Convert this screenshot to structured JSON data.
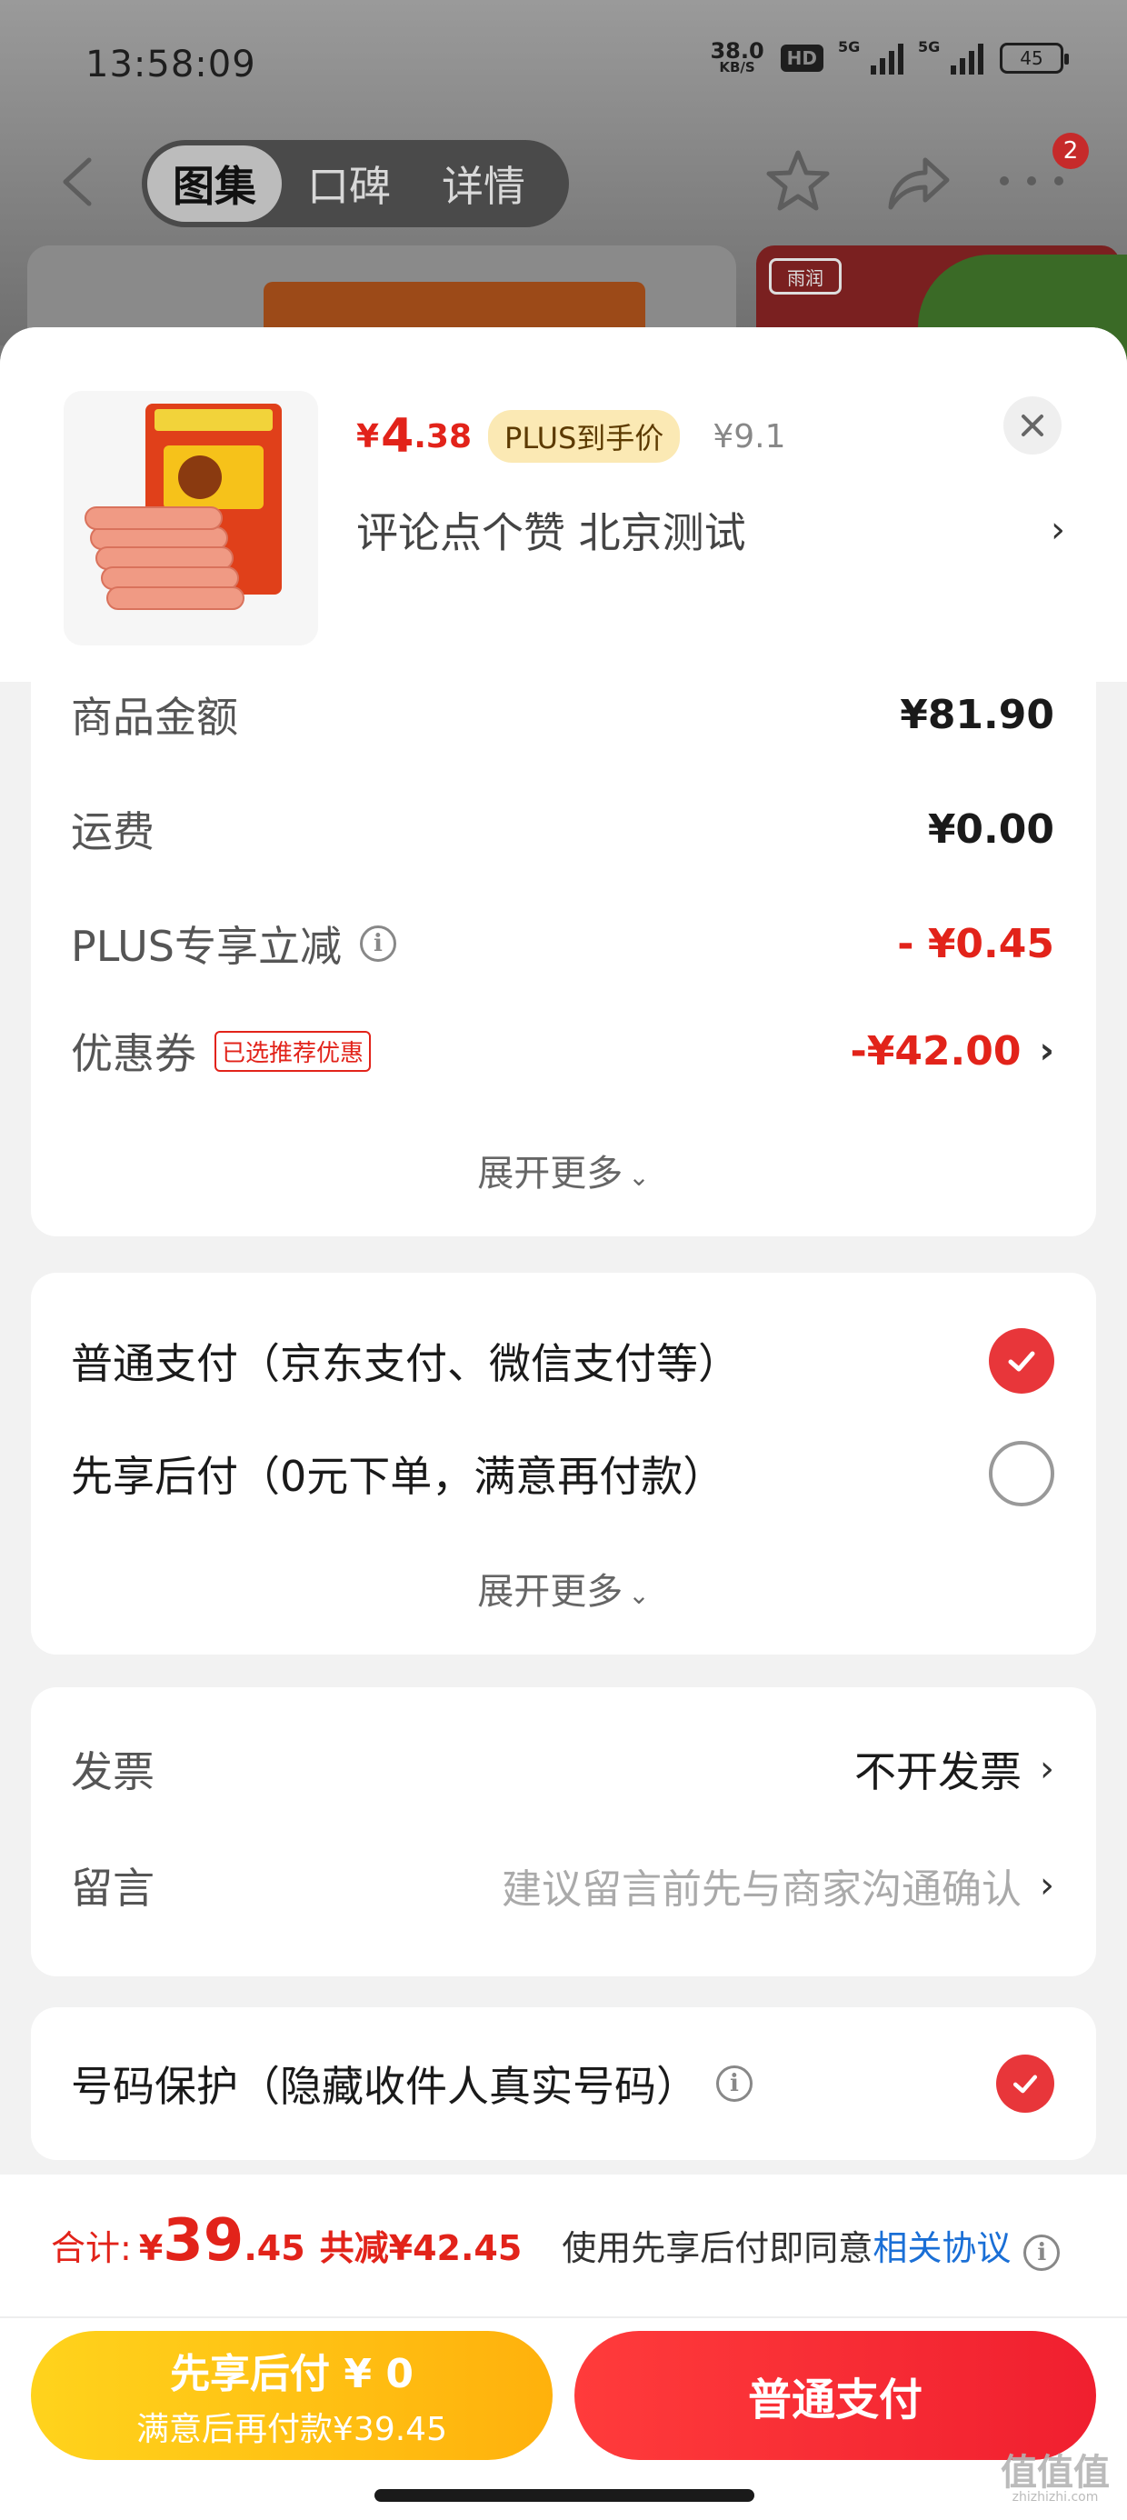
{
  "status_bar": {
    "time": "13:58:09",
    "net_speed": "38.0",
    "net_unit": "KB/S",
    "hd": "HD",
    "sig1": "5G",
    "sig2": "5G",
    "battery": "45"
  },
  "nav": {
    "tabs": [
      {
        "label": "图集",
        "active": true
      },
      {
        "label": "口碑",
        "active": false
      },
      {
        "label": "详情",
        "active": false
      }
    ],
    "more_badge": "2",
    "bg_logo": "雨润"
  },
  "product": {
    "price_symbol": "¥",
    "price_int": "4",
    "price_dec": ".38",
    "plus_tag": "PLUS到手价",
    "orig_price": "¥9.1",
    "spec": "评论点个赞  北京测试"
  },
  "price_detail": {
    "rows": [
      {
        "label": "商品金额",
        "value": "¥81.90"
      },
      {
        "label": "运费",
        "value": "¥0.00"
      },
      {
        "label": "PLUS专享立减",
        "value": "- ¥0.45"
      },
      {
        "label": "优惠券",
        "tag": "已选推荐优惠",
        "value": "-¥42.00"
      }
    ],
    "expand": "展开更多"
  },
  "payment": {
    "options": [
      {
        "label": "普通支付（京东支付、微信支付等）",
        "selected": true
      },
      {
        "label": "先享后付（0元下单，满意再付款）",
        "selected": false
      }
    ],
    "expand": "展开更多"
  },
  "invoice": {
    "label": "发票",
    "value": "不开发票",
    "note_label": "留言",
    "note_placeholder": "建议留言前先与商家沟通确认"
  },
  "protection": {
    "label": "号码保护（隐藏收件人真实号码）",
    "checked": true
  },
  "footer": {
    "total_label": "合计:",
    "total_symbol": "¥",
    "total_int": "39",
    "total_dec": ".45",
    "total_save": "共减¥42.45",
    "agree_text": "使用先享后付即同意",
    "agree_link": "相关协议",
    "btn_later_line1": "先享后付 ¥ 0",
    "btn_later_line2": "满意后再付款¥39.45",
    "btn_pay": "普通支付"
  },
  "watermark": {
    "text": "值值值",
    "url": "zhizhizhi.com"
  },
  "colors": {
    "accent_red": "#e2231a",
    "link_blue": "#1a6fd6",
    "later_button": "#ffc414",
    "pay_button": "#f22a35",
    "plus_tag_bg": "#fbe9b4"
  }
}
